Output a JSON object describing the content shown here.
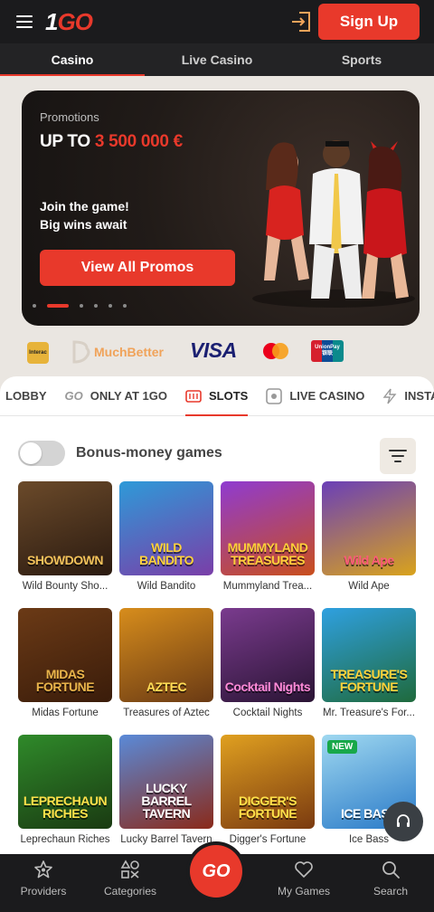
{
  "header": {
    "logo_one": "1",
    "logo_go": "GO",
    "signup_label": "Sign Up"
  },
  "top_tabs": [
    {
      "label": "Casino",
      "active": true
    },
    {
      "label": "Live Casino",
      "active": false
    },
    {
      "label": "Sports",
      "active": false
    }
  ],
  "promo": {
    "label": "Promotions",
    "title_prefix": "UP TO",
    "title_amount": "3 500 000 €",
    "subtitle_line1": "Join the game!",
    "subtitle_line2": "Big wins await",
    "button_label": "View All Promos",
    "slide_count": 7,
    "active_slide": 2
  },
  "payments": {
    "interac": "Interac",
    "muchbetter": "MuchBetter",
    "visa": "VISA",
    "unionpay": "UnionPay",
    "unionpay_cn": "银联"
  },
  "categories": [
    {
      "label": "LOBBY",
      "icon": "lobby-icon",
      "active": false
    },
    {
      "label": "ONLY AT 1GO",
      "icon": "go-icon",
      "icon_text": "GO",
      "active": false
    },
    {
      "label": "SLOTS",
      "icon": "slots-icon",
      "active": true
    },
    {
      "label": "LIVE CASINO",
      "icon": "live-icon",
      "active": false
    },
    {
      "label": "INSTAN",
      "icon": "lightning-icon",
      "active": false
    }
  ],
  "bonus": {
    "label": "Bonus-money games",
    "toggle_on": false
  },
  "games": [
    {
      "name": "Wild Bounty Sho...",
      "thumb_text": "SHOWDOWN",
      "c1": "#6b4a2a",
      "c2": "#2a1a10",
      "tc": "#f2c15a"
    },
    {
      "name": "Wild Bandito",
      "thumb_text": "WILD BANDITO",
      "c1": "#2e9ad8",
      "c2": "#7a3ea8",
      "tc": "#ffd23a"
    },
    {
      "name": "Mummyland Trea...",
      "thumb_text": "MUMMYLAND TREASURES",
      "c1": "#8f3bd1",
      "c2": "#c94f1c",
      "tc": "#ffcf3a"
    },
    {
      "name": "Wild Ape",
      "thumb_text": "Wild Ape",
      "c1": "#6a3fb8",
      "c2": "#d9a31c",
      "tc": "#ff5a7a"
    },
    {
      "name": "Midas Fortune",
      "thumb_text": "MIDAS FORTUNE",
      "c1": "#6b3a16",
      "c2": "#3a1c0a",
      "tc": "#e9b44a"
    },
    {
      "name": "Treasures of Aztec",
      "thumb_text": "AZTEC",
      "c1": "#d78d1c",
      "c2": "#6a3a14",
      "tc": "#ffdd55"
    },
    {
      "name": "Cocktail Nights",
      "thumb_text": "Cocktail Nights",
      "c1": "#7a3b8e",
      "c2": "#2a1434",
      "tc": "#ff8ad8"
    },
    {
      "name": "Mr. Treasure's For...",
      "thumb_text": "TREASURE'S FORTUNE",
      "c1": "#2fa0e0",
      "c2": "#1f6a3c",
      "tc": "#ffd23a"
    },
    {
      "name": "Leprechaun Riches",
      "thumb_text": "LEPRECHAUN RICHES",
      "c1": "#2f8a2a",
      "c2": "#1a3a12",
      "tc": "#ffe14a"
    },
    {
      "name": "Lucky Barrel Tavern",
      "thumb_text": "LUCKY BARREL TAVERN",
      "c1": "#5a8ad8",
      "c2": "#8a2a1a",
      "tc": "#ffffff"
    },
    {
      "name": "Digger's Fortune",
      "thumb_text": "DIGGER'S FORTUNE",
      "c1": "#e0a020",
      "c2": "#7a3a10",
      "tc": "#ffe14a"
    },
    {
      "name": "Ice Bass",
      "thumb_text": "ICE BASS",
      "badge": "NEW",
      "c1": "#9fd8f0",
      "c2": "#2a7ac8",
      "tc": "#ffffff"
    }
  ],
  "bottom_nav": [
    {
      "label": "Providers",
      "icon": "star-icon"
    },
    {
      "label": "Categories",
      "icon": "categories-icon"
    },
    {
      "label": "My Games",
      "icon": "heart-icon"
    },
    {
      "label": "Search",
      "icon": "search-icon"
    }
  ],
  "go_button": "GO",
  "colors": {
    "accent": "#e8392b",
    "dark": "#1b1b1d",
    "page_bg": "#eae6e1"
  }
}
